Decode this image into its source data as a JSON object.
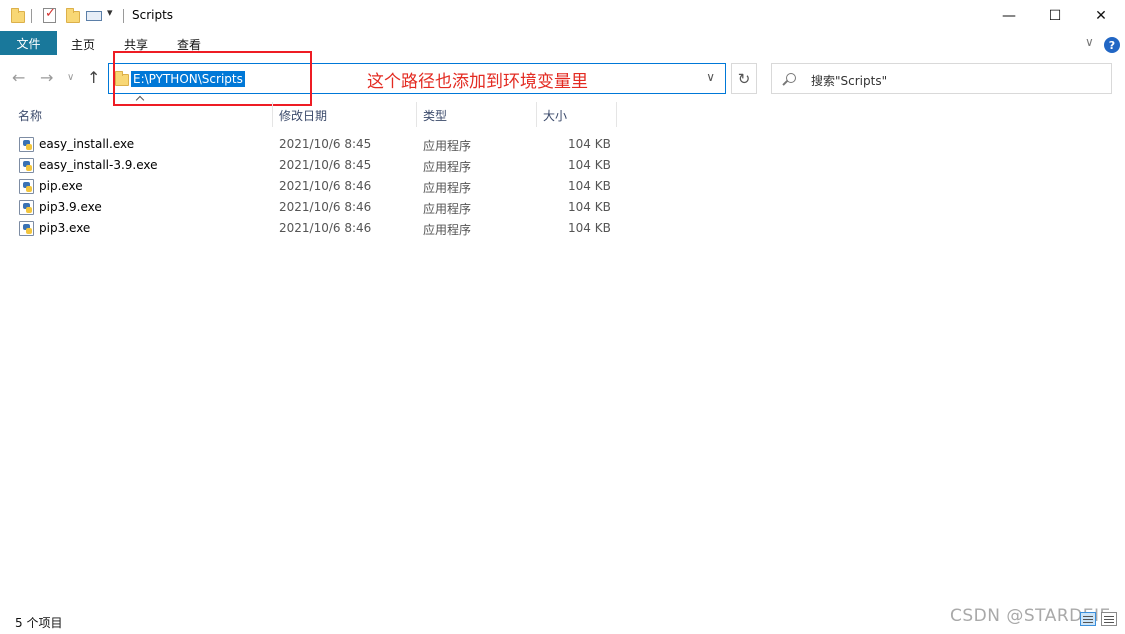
{
  "window": {
    "title": "Scripts",
    "controls": {
      "minimize": "—",
      "maximize": "☐",
      "close": "✕"
    },
    "quick_access_icons": [
      "folder-icon",
      "properties-check-icon",
      "new-folder-icon",
      "customize-icon"
    ],
    "quick_access_dropdown": "▾"
  },
  "ribbon": {
    "tabs": [
      "文件",
      "主页",
      "共享",
      "查看"
    ],
    "expand_glyph": "∨",
    "help_glyph": "?"
  },
  "nav": {
    "back": "←",
    "forward": "→",
    "recent": "∨",
    "up": "↑",
    "address": "E:\\PYTHON\\Scripts",
    "address_dropdown": "∨",
    "refresh": "↻",
    "search_placeholder": "搜索\"Scripts\""
  },
  "annotation": {
    "text": "这个路径也添加到环境变量里",
    "color": "#ee1c24"
  },
  "columns": {
    "name": "名称",
    "date": "修改日期",
    "type": "类型",
    "size": "大小"
  },
  "files": [
    {
      "name": "easy_install.exe",
      "date": "2021/10/6 8:45",
      "type": "应用程序",
      "size": "104 KB"
    },
    {
      "name": "easy_install-3.9.exe",
      "date": "2021/10/6 8:45",
      "type": "应用程序",
      "size": "104 KB"
    },
    {
      "name": "pip.exe",
      "date": "2021/10/6 8:46",
      "type": "应用程序",
      "size": "104 KB"
    },
    {
      "name": "pip3.9.exe",
      "date": "2021/10/6 8:46",
      "type": "应用程序",
      "size": "104 KB"
    },
    {
      "name": "pip3.exe",
      "date": "2021/10/6 8:46",
      "type": "应用程序",
      "size": "104 KB"
    }
  ],
  "status": {
    "item_count": "5 个项目"
  },
  "watermark": "CSDN @STARDEIE",
  "colors": {
    "file_tab": "#19789b",
    "selection": "#0078d7",
    "help": "#2166c4"
  }
}
